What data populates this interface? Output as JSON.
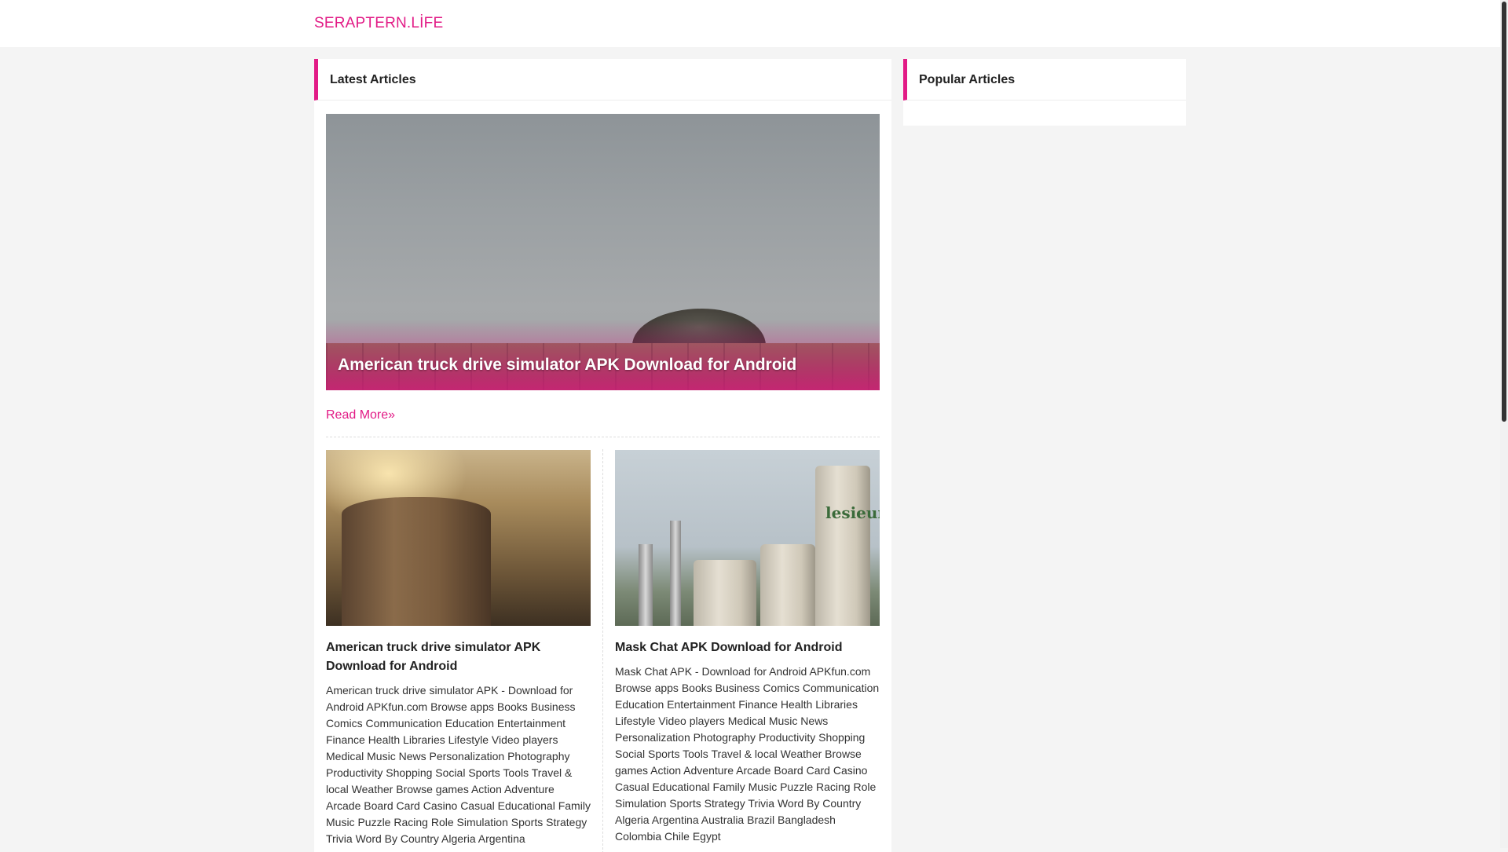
{
  "header": {
    "brand": "SERAPTERN.LİFE"
  },
  "main": {
    "section_title": "Latest Articles",
    "featured": {
      "title": "American truck drive simulator APK Download for Android",
      "read_more": "Read More»"
    },
    "cards": [
      {
        "title": "American truck drive simulator APK Download for Android",
        "excerpt": "American truck drive simulator APK - Download for Android APKfun.com Browse apps Books Business Comics Communication Education Entertainment Finance Health Libraries Lifestyle Video players Medical Music News Personalization Photography Productivity Shopping Social Sports Tools Travel & local Weather Browse games Action Adventure Arcade Board Card Casino Casual Educational Family Music Puzzle Racing Role Simulation Sports Strategy Trivia Word By Country Algeria Argentina"
      },
      {
        "title": "Mask Chat APK Download for Android",
        "excerpt": "Mask Chat APK - Download for Android APKfun.com Browse apps Books Business Comics Communication Education Entertainment Finance Health Libraries Lifestyle Video players Medical Music News Personalization Photography Productivity Shopping Social Sports Tools Travel & local Weather Browse games Action Adventure Arcade Board Card Casino Casual Educational Family Music Puzzle Racing Role Simulation Sports Strategy Trivia Word By Country Algeria Argentina Australia Brazil Bangladesh Colombia Chile Egypt",
        "image_text": "lesieur"
      }
    ]
  },
  "sidebar": {
    "section_title": "Popular Articles"
  },
  "colors": {
    "accent": "#e21b86",
    "background": "#f4f4f4"
  }
}
